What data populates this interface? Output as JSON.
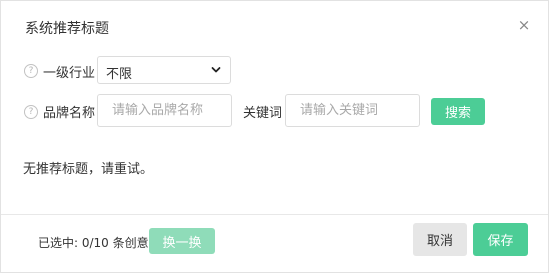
{
  "dialog": {
    "title": "系统推荐标题",
    "close_icon": "×"
  },
  "filters": {
    "industry_label": "一级行业",
    "industry_selected": "不限",
    "brand_label": "品牌名称",
    "brand_placeholder": "请输入品牌名称",
    "keyword_label": "关键词",
    "keyword_placeholder": "请输入关键词",
    "search_button": "搜索",
    "help_icon_glyph": "?"
  },
  "result": {
    "empty_message": "无推荐标题，请重试。"
  },
  "footer": {
    "selected_text": "已选中: 0/10 条创意",
    "swap_button": "换一换",
    "cancel_button": "取消",
    "save_button": "保存"
  },
  "icons": {
    "close": "close-icon",
    "help": "question-circle-icon",
    "dropdown": "chevron-down-icon"
  },
  "colors": {
    "primary": "#4ccd96",
    "primary_disabled": "#8fdcb9",
    "cancel_bg": "#e6e6e6"
  }
}
